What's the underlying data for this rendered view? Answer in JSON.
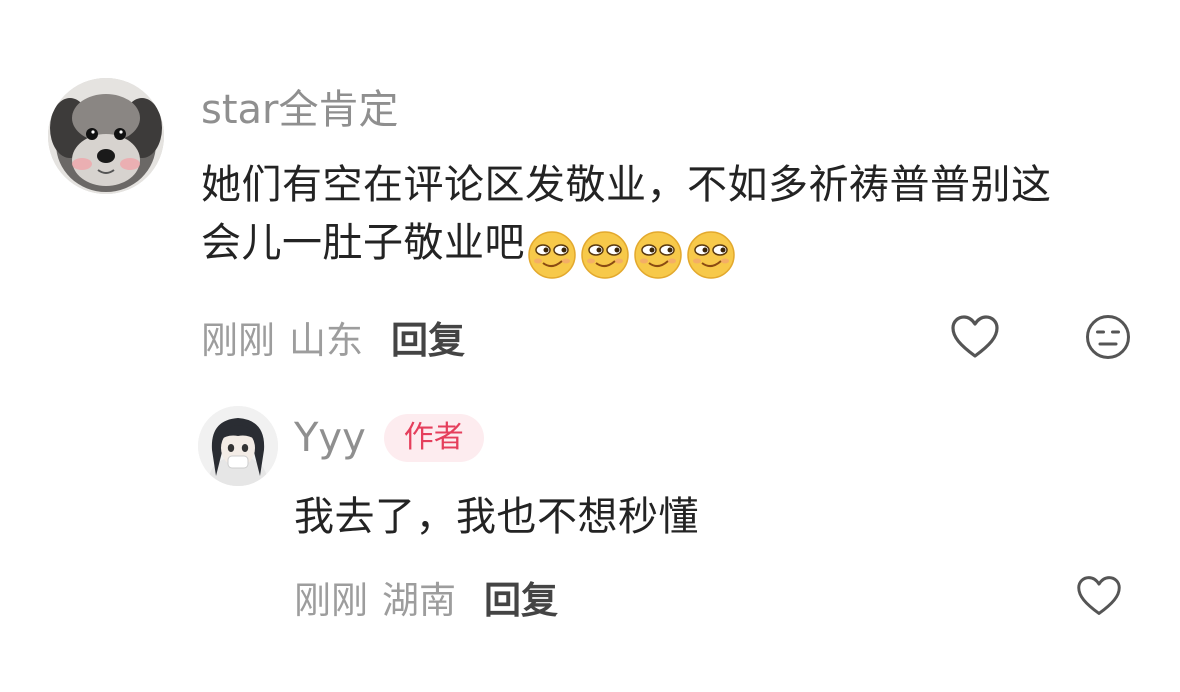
{
  "main_comment": {
    "author": "star全肯定",
    "avatar_icon": "schnauzer-dog-avatar",
    "text_lines": [
      "她们有空在评论区发敬业，不如多祈祷普普别这",
      "会儿一肚子敬业吧"
    ],
    "emoji_icon": "smirk-emoji",
    "emoji_count": 4,
    "time": "刚刚",
    "location": "山东",
    "reply_label": "回复",
    "like_icon": "heart-outline-icon",
    "dislike_icon": "meh-face-icon"
  },
  "reply": {
    "author": "Yyy",
    "avatar_icon": "anime-girl-avatar",
    "badge": "作者",
    "text": "我去了，我也不想秒懂",
    "time": "刚刚",
    "location": "湖南",
    "reply_label": "回复",
    "like_icon": "heart-outline-icon"
  },
  "colors": {
    "author": "#8f8f8f",
    "meta": "#9d9d9d",
    "text": "#232323",
    "badge_bg": "#fdecef",
    "badge_text": "#e53f5c",
    "emoji": "#f7c94a"
  }
}
